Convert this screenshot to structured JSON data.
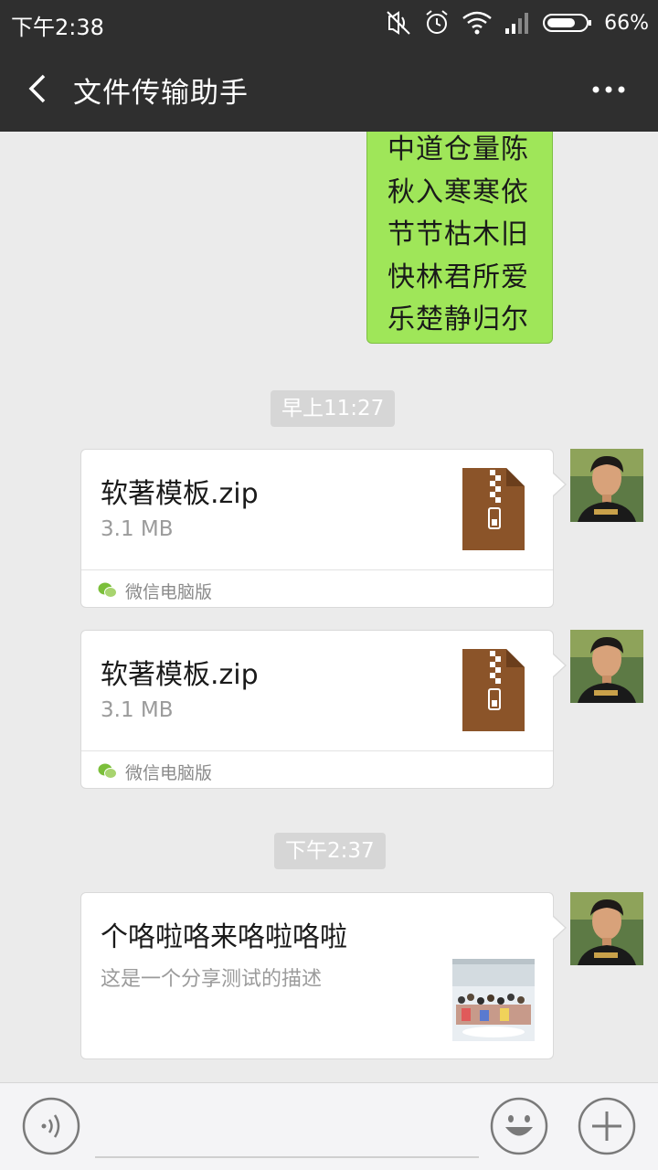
{
  "status_bar": {
    "time": "下午2:38",
    "battery_pct": "66%",
    "icons": [
      "mute-vibrate-icon",
      "alarm-icon",
      "wifi-icon",
      "signal-icon",
      "battery-icon"
    ]
  },
  "header": {
    "title": "文件传输助手",
    "back_icon": "chevron-left-icon",
    "more_icon": "more-dots-icon"
  },
  "messages": {
    "poem_lines": [
      "中道仓量陈",
      "秋入寒寒依",
      "节节枯木旧",
      "快林君所爱",
      "乐楚静归尔"
    ],
    "timestamp_1": "早上11:27",
    "file_1": {
      "name": "软著模板.zip",
      "size": "3.1 MB",
      "source": "微信电脑版"
    },
    "file_2": {
      "name": "软著模板.zip",
      "size": "3.1 MB",
      "source": "微信电脑版"
    },
    "timestamp_2": "下午2:37",
    "share": {
      "title": "个咯啦咯来咯啦咯啦",
      "description": "这是一个分享测试的描述"
    }
  },
  "input_bar": {
    "placeholder": "",
    "icons": [
      "voice-icon",
      "emoji-icon",
      "plus-icon"
    ]
  },
  "colors": {
    "header_bg": "#2f2f2f",
    "chat_bg": "#ebebeb",
    "bubble_green": "#9fe659",
    "zip_brown": "#8b5429",
    "timestamp_bg": "#d6d6d6"
  }
}
